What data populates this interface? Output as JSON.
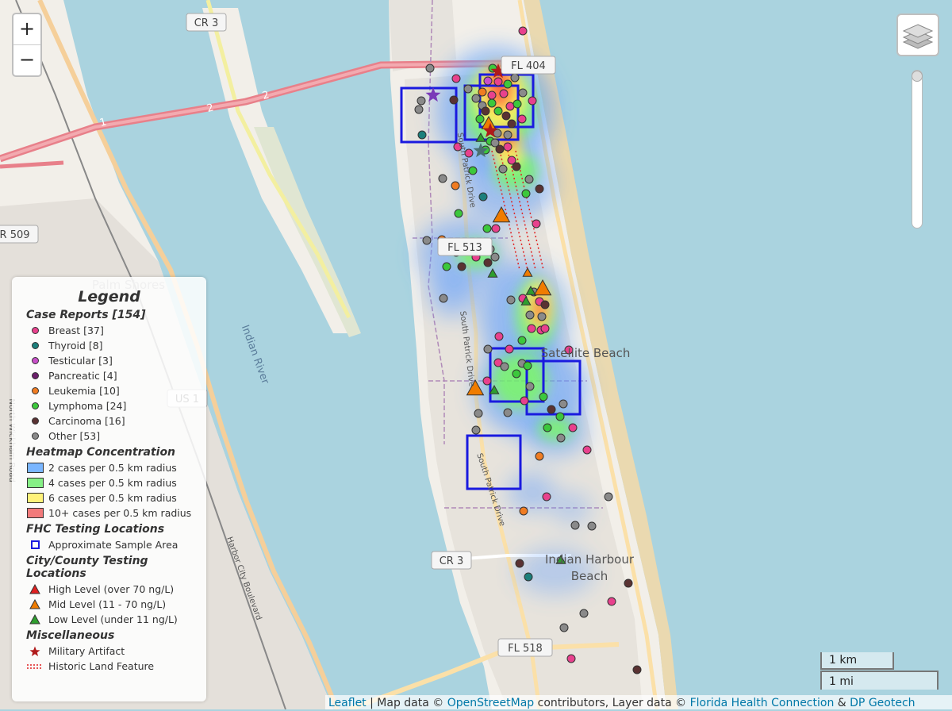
{
  "map": {
    "road_labels": [
      "CR 3",
      "CR 509",
      "FL 513",
      "FL 404",
      "US 1",
      "CR 3",
      "FL 518",
      "1",
      "2",
      "2"
    ],
    "place_labels": [
      "Palm Shores",
      "Indian River",
      "Satellite Beach",
      "Indian Harbour Beach"
    ],
    "street_labels": [
      "South Patrick Drive",
      "South Patrick Drive",
      "South Patrick Drive",
      "North Wickham Road",
      "Harbor City Boulevard"
    ],
    "colors": {
      "water": "#aad3df",
      "land": "#f2efe9",
      "breast": "#e8418d",
      "thyroid": "#1c7f7b",
      "testicular": "#c84fc8",
      "pancreatic": "#6a1f6a",
      "leukemia": "#f07c22",
      "lymphoma": "#3cc83c",
      "carcinoma": "#5a3232",
      "other": "#8a8a8a",
      "testing_area": "#1a1adf",
      "high_level": "#e02020",
      "mid_level": "#f07c00",
      "low_level": "#2e9e2e"
    }
  },
  "controls": {
    "zoom_in": "+",
    "zoom_out": "−",
    "layers_icon": "layers-icon"
  },
  "legend": {
    "title": "Legend",
    "sections": [
      {
        "title": "Case Reports [154]",
        "items": [
          {
            "label": "Breast [37]",
            "symbol": "dot",
            "color": "#e8418d"
          },
          {
            "label": "Thyroid [8]",
            "symbol": "dot",
            "color": "#1c7f7b"
          },
          {
            "label": "Testicular [3]",
            "symbol": "dot",
            "color": "#c84fc8"
          },
          {
            "label": "Pancreatic [4]",
            "symbol": "dot",
            "color": "#6a1f6a"
          },
          {
            "label": "Leukemia [10]",
            "symbol": "dot",
            "color": "#f07c22"
          },
          {
            "label": "Lymphoma [24]",
            "symbol": "dot",
            "color": "#3cc83c"
          },
          {
            "label": "Carcinoma [16]",
            "symbol": "dot",
            "color": "#5a3232"
          },
          {
            "label": "Other [53]",
            "symbol": "dot",
            "color": "#8a8a8a"
          }
        ]
      },
      {
        "title": "Heatmap Concentration",
        "items": [
          {
            "label": "2 cases per 0.5 km radius",
            "symbol": "swatch",
            "color": "#7ab6ff"
          },
          {
            "label": "4 cases per 0.5 km radius",
            "symbol": "swatch",
            "color": "#86f086"
          },
          {
            "label": "6 cases per 0.5 km radius",
            "symbol": "swatch",
            "color": "#fff27a"
          },
          {
            "label": "10+ cases per 0.5 km radius",
            "symbol": "swatch",
            "color": "#f27a7a"
          }
        ]
      },
      {
        "title": "FHC Testing Locations",
        "items": [
          {
            "label": "Approximate Sample Area",
            "symbol": "square",
            "color": "#1a1adf"
          }
        ]
      },
      {
        "title": "City/County Testing Locations",
        "items": [
          {
            "label": "High Level (over 70 ng/L)",
            "symbol": "triangle",
            "color": "#e02020"
          },
          {
            "label": "Mid Level (11 - 70 ng/L)",
            "symbol": "triangle",
            "color": "#f07c00"
          },
          {
            "label": "Low Level (under 11 ng/L)",
            "symbol": "triangle",
            "color": "#2e9e2e"
          }
        ]
      },
      {
        "title": "Miscellaneous",
        "items": [
          {
            "label": "Military Artifact",
            "symbol": "star",
            "color": "#b01a1a"
          },
          {
            "label": "Historic Land Feature",
            "symbol": "dotted",
            "color": "#e02020"
          }
        ]
      }
    ]
  },
  "scale": {
    "km": "1 km",
    "mi": "1 mi"
  },
  "attribution": {
    "leaflet": "Leaflet",
    "sep1": " | Map data © ",
    "osm": "OpenStreetMap",
    "mid": " contributors, Layer data © ",
    "fhc": "Florida Health Connection",
    "amp": " & ",
    "dp": "DP Geotech"
  }
}
